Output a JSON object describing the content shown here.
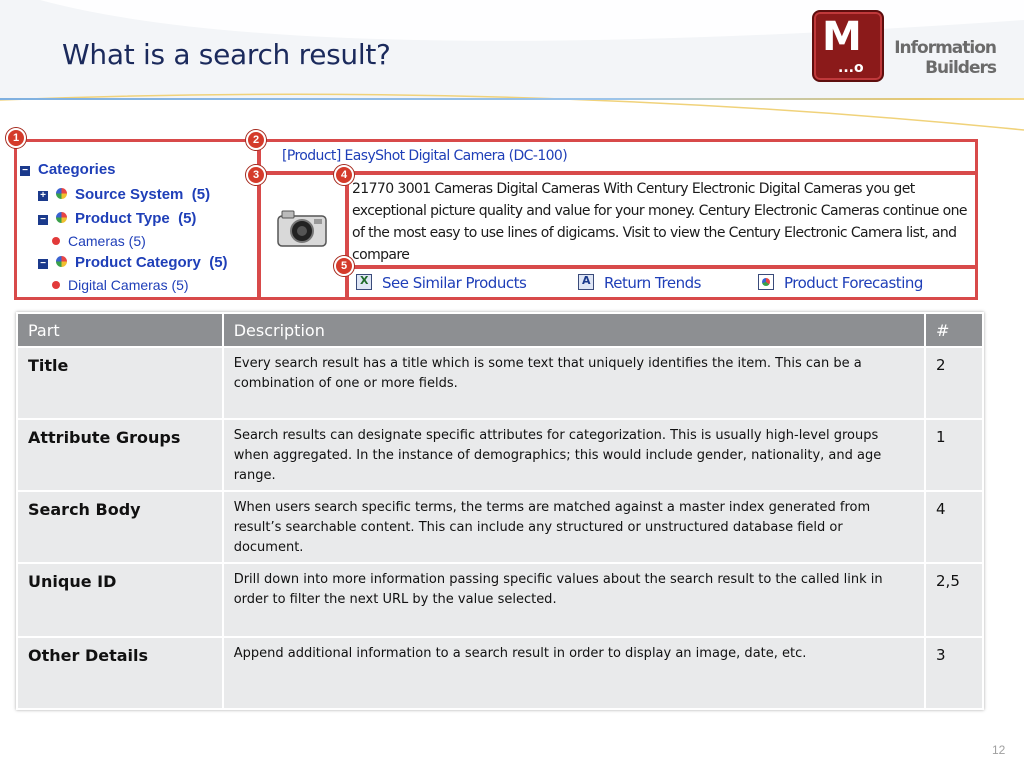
{
  "slide": {
    "title": "What is a search result?",
    "page_number": "12"
  },
  "logo": {
    "letter": "M",
    "dots": "...o",
    "line1": "Information",
    "line2": "Builders"
  },
  "screenshot": {
    "badges": [
      "1",
      "2",
      "3",
      "4",
      "5"
    ],
    "categories": {
      "header": "Categories",
      "items": [
        {
          "label": "Source System",
          "count": "(5)"
        },
        {
          "label": "Product Type",
          "count": "(5)"
        },
        {
          "label": "Cameras (5)"
        },
        {
          "label": "Product Category",
          "count": "(5)"
        },
        {
          "label": "Digital Cameras (5)"
        }
      ]
    },
    "result_title": "[Product] EasyShot Digital Camera (DC-100)",
    "result_body": "21770 3001 Cameras Digital Cameras With Century Electronic Digital Cameras you get exceptional picture quality and value for your money. Century Electronic Cameras continue one of the most easy to use lines of digicams. Visit to view the Century Electronic Camera list, and compare",
    "links": [
      {
        "label": "See Similar Products",
        "icon": "excel-icon"
      },
      {
        "label": "Return Trends",
        "icon": "report-icon"
      },
      {
        "label": "Product Forecasting",
        "icon": "forecast-icon"
      }
    ]
  },
  "table": {
    "headers": [
      "Part",
      "Description",
      "#"
    ],
    "rows": [
      {
        "part": "Title",
        "description": "Every search result has a title which is some text that uniquely identifies the item.  This can be a combination of one or more fields.",
        "num": "2"
      },
      {
        "part": "Attribute Groups",
        "description": "Search results can designate  specific attributes for categorization.  This is usually high-level groups when aggregated.  In the instance of demographics;  this would include gender, nationality, and age range.",
        "num": "1"
      },
      {
        "part": "Search Body",
        "description": "When users search specific terms, the terms are matched against a master index generated from result’s searchable content.  This can include any structured or unstructured database field or document.",
        "num": "4"
      },
      {
        "part": "Unique ID",
        "description": "Drill down into more information passing specific values about the search result to the called link in order to filter the next URL by the value selected.",
        "num": "2,5"
      },
      {
        "part": "Other Details",
        "description": "Append additional information to a search result in order to display an image, date, etc.",
        "num": "3"
      }
    ]
  },
  "colors": {
    "title": "#1b2a5c",
    "highlight_box": "#d84a4a",
    "link": "#1f3fb8",
    "table_header": "#8d8f92",
    "table_cell": "#e9eaeb"
  }
}
